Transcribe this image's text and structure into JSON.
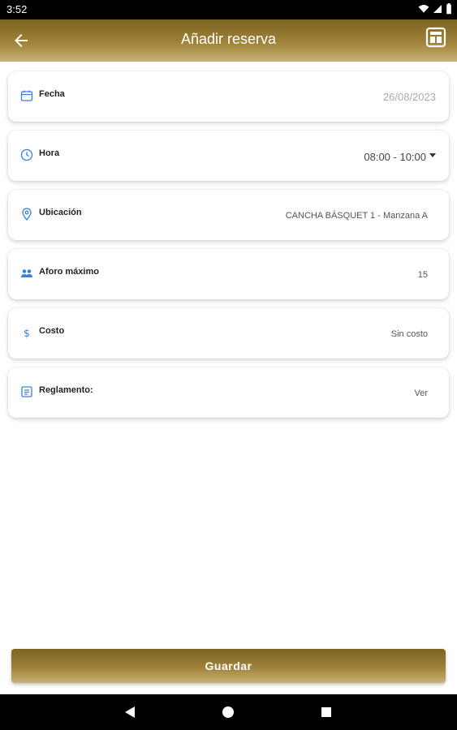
{
  "status": {
    "time": "3:52"
  },
  "header": {
    "title": "Añadir reserva"
  },
  "fields": [
    {
      "label": "Fecha",
      "value": "26/08/2023",
      "icon": "calendar-icon"
    },
    {
      "label": "Hora",
      "value": "08:00 - 10:00",
      "icon": "clock-icon"
    },
    {
      "label": "Ubicación",
      "value": "CANCHA BÁSQUET 1 - Manzana A",
      "icon": "location-pin-icon"
    },
    {
      "label": "Aforo máximo",
      "value": "15",
      "icon": "people-icon"
    },
    {
      "label": "Costo",
      "value": "Sin costo",
      "icon": "dollar-icon"
    },
    {
      "label": "Reglamento:",
      "value": "Ver",
      "icon": "document-icon"
    }
  ],
  "actions": {
    "save_label": "Guardar"
  },
  "colors": {
    "accent": "#a0823a",
    "icon_blue": "#3b7fd9"
  }
}
